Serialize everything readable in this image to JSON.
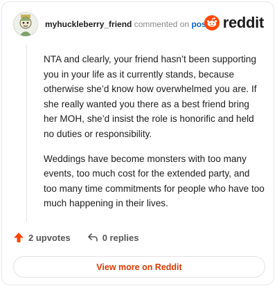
{
  "header": {
    "username": "myhuckleberry_friend",
    "action_text": "commented on",
    "post_link": "post",
    "brand_name": "reddit"
  },
  "comment": {
    "paragraphs": [
      "NTA and clearly, your friend hasn’t been supporting you in your life as it currently stands, because otherwise she’d know how overwhelmed you are. If she really wanted you there as a best friend bring her MOH, she’d insist the role is honorific and held no duties or responsibility.",
      "Weddings have become monsters with too many events, too much cost for the extended party, and too many time commitments for people who have too much happening in their lives."
    ]
  },
  "actions": {
    "upvotes": "2 upvotes",
    "replies": "0 replies"
  },
  "footer": {
    "view_more": "View more on Reddit"
  },
  "colors": {
    "brand_orange": "#ff4500",
    "link_blue": "#0a66c2",
    "upvote_orange": "#ff4500"
  },
  "icons": {
    "avatar": "snoo-avatar",
    "logo": "reddit-logo-icon",
    "upvote": "upvote-arrow-icon",
    "reply": "reply-arrow-icon"
  }
}
